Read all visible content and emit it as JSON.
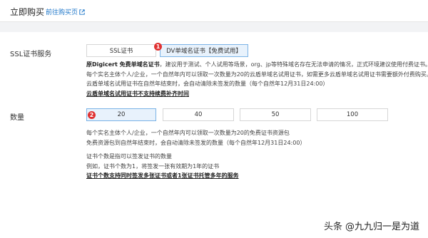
{
  "header": {
    "title": "立即购买",
    "link": "前往购买页",
    "link_icon": "external-link-icon"
  },
  "ssl": {
    "label": "SSL证书服务",
    "options": [
      {
        "label": "SSL证书",
        "selected": false
      },
      {
        "label": "DV单域名证书【免费试用】",
        "selected": true
      }
    ],
    "badge": "1",
    "desc": [
      {
        "prefix": "原Digicert 免费单域名证书",
        "text": "，建议用于测试、个人试用等场景，org、jp等特殊域名存在无法申请的情况，正式环境建议使用付费证书。"
      },
      {
        "text": "每个实名主体个人/企业，一个自然年内可以领取一次数量为20的云盾单域名试用证书，如需更多云盾单域名试用证书需要额外付费购买。"
      },
      {
        "text": "云盾单域名试用证书在自然年结束时，会自动清除未签发的数量（每个自然年12月31日24:00）"
      },
      {
        "text": "云盾单域名试用证书不支持续费补齐时间"
      }
    ]
  },
  "quantity": {
    "label": "数量",
    "options": [
      {
        "label": "20",
        "selected": true
      },
      {
        "label": "40",
        "selected": false
      },
      {
        "label": "50",
        "selected": false
      },
      {
        "label": "100",
        "selected": false
      }
    ],
    "badge": "2",
    "desc1": [
      "每个实名主体个人/企业，一个自然年内可以领取一次数量为20的免费证书资源包",
      "免费资源包到自然年结束时，会自动清除未签发的数量（每个自然年12月31日24:00）"
    ],
    "desc2": [
      "证书个数是指可以签发证书的数量",
      "例如，证书个数为1，将签发一张有效期为1年的证书",
      "证书个数支持同时签发多张证书或者1张证书托管多年的服务"
    ]
  },
  "watermark": {
    "platform": "头条",
    "handle": "@九九归一是为道"
  }
}
